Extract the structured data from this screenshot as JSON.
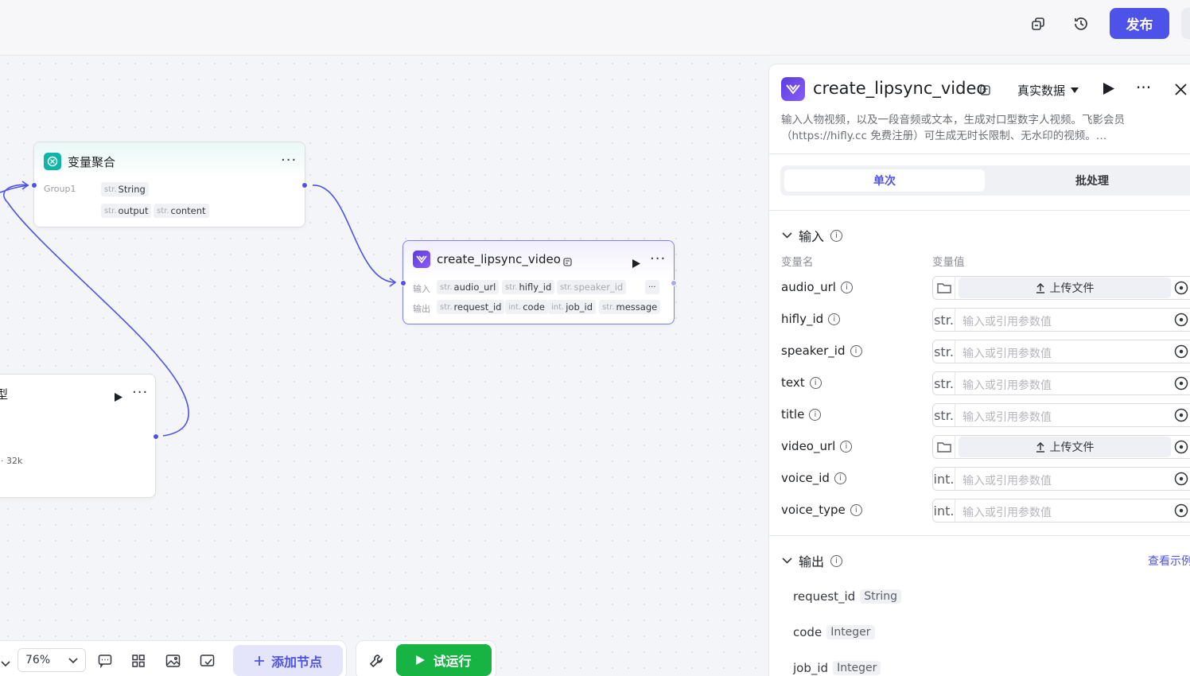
{
  "topbar": {
    "copy_icon": "copy-icon",
    "history_icon": "history-icon",
    "publish_label": "发布"
  },
  "nodes": {
    "aggregator": {
      "title": "变量聚合",
      "group_label": "Group1",
      "group_var": {
        "type": "str.",
        "name": "String"
      },
      "outputs": [
        {
          "type": "str.",
          "name": "output"
        },
        {
          "type": "str.",
          "name": "content"
        }
      ]
    },
    "lipsync": {
      "title": "create_lipsync_video",
      "input_label": "输入",
      "output_label": "输出",
      "inputs": [
        {
          "type": "str.",
          "name": "audio_url"
        },
        {
          "type": "str.",
          "name": "hifly_id"
        },
        {
          "type": "str.",
          "name": "speaker_id"
        }
      ],
      "inputs_more": "···",
      "outputs": [
        {
          "type": "str.",
          "name": "request_id"
        },
        {
          "type": "int.",
          "name": "code"
        },
        {
          "type": "int.",
          "name": "job_id"
        },
        {
          "type": "str.",
          "name": "message"
        }
      ]
    },
    "partial": {
      "title_fragment": "型",
      "meta_fragment": "· 32k"
    }
  },
  "toolbar": {
    "zoom": "76%",
    "add_node_label": "添加节点",
    "run_label": "试运行"
  },
  "panel": {
    "title": "create_lipsync_video",
    "data_mode": "真实数据",
    "description": "输入人物视频，以及一段音频或文本，生成对口型数字人视频。飞影会员（https://hifly.cc 免费注册）可生成无时长限制、无水印的视频。…",
    "tabs": [
      "单次",
      "批处理"
    ],
    "input_section": "输入",
    "col_name": "变量名",
    "col_value": "变量值",
    "upload_label": "上传文件",
    "placeholder": "输入或引用参数值",
    "fields": [
      {
        "name": "audio_url",
        "kind": "file"
      },
      {
        "name": "hifly_id",
        "kind": "text",
        "type": "str."
      },
      {
        "name": "speaker_id",
        "kind": "text",
        "type": "str."
      },
      {
        "name": "text",
        "kind": "text",
        "type": "str."
      },
      {
        "name": "title",
        "kind": "text",
        "type": "str."
      },
      {
        "name": "video_url",
        "kind": "file"
      },
      {
        "name": "voice_id",
        "kind": "text",
        "type": "int."
      },
      {
        "name": "voice_type",
        "kind": "text",
        "type": "int."
      }
    ],
    "output_section": "输出",
    "view_example": "查看示例",
    "outputs": [
      {
        "name": "request_id",
        "type": "String"
      },
      {
        "name": "code",
        "type": "Integer"
      },
      {
        "name": "job_id",
        "type": "Integer"
      }
    ]
  },
  "colors": {
    "accent": "#4d53e8",
    "run": "#17b444",
    "teal": "#10b4a8"
  }
}
